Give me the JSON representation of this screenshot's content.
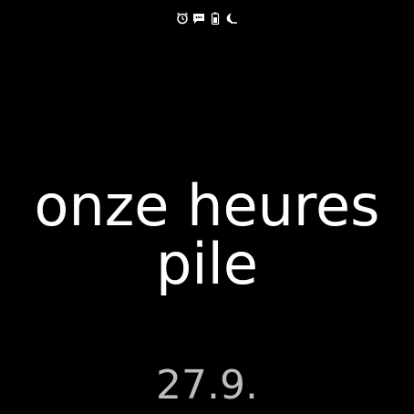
{
  "status_bar": {
    "icons": [
      "alarm-icon",
      "message-icon",
      "battery-icon",
      "do-not-disturb-icon"
    ]
  },
  "watchface": {
    "time_line_1": "onze heures",
    "time_line_2": "pile",
    "date": "27.9."
  },
  "colors": {
    "background": "#000000",
    "time_text": "#ffffff",
    "date_text": "#bdbdbd"
  }
}
